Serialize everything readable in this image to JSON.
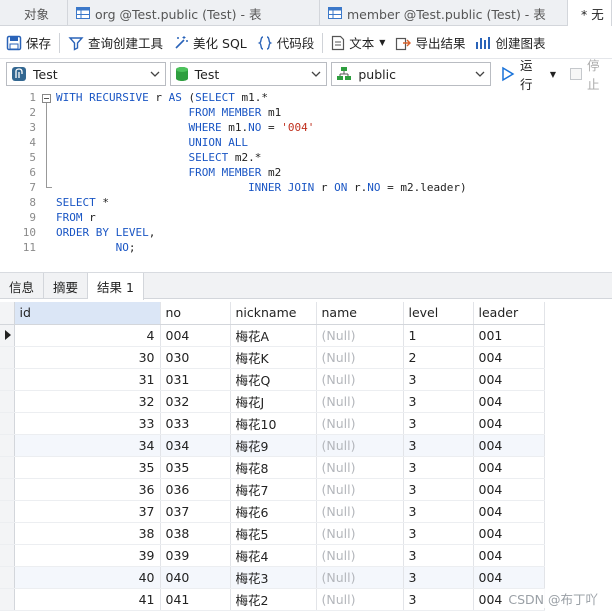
{
  "tabs": [
    {
      "label": "对象",
      "active": false
    },
    {
      "label": "org @Test.public (Test) - 表",
      "active": false
    },
    {
      "label": "member @Test.public (Test) - 表",
      "active": false
    },
    {
      "label": "* 无",
      "active": true
    }
  ],
  "toolbar": {
    "save": "保存",
    "query_builder": "查询创建工具",
    "beautify": "美化 SQL",
    "code_snippet": "代码段",
    "text": "文本",
    "export": "导出结果",
    "chart": "创建图表"
  },
  "selectors": {
    "connection": "Test",
    "database": "Test",
    "schema": "public",
    "run": "运行",
    "stop": "停止"
  },
  "editor": {
    "line_numbers": [
      "1",
      "2",
      "3",
      "4",
      "5",
      "6",
      "7",
      "8",
      "9",
      "10",
      "11"
    ]
  },
  "result_tabs": [
    "信息",
    "摘要",
    "结果 1"
  ],
  "grid": {
    "columns": [
      "id",
      "no",
      "nickname",
      "name",
      "level",
      "leader"
    ],
    "rows": [
      [
        "4",
        "004",
        "梅花A",
        "(Null)",
        "1",
        "001"
      ],
      [
        "30",
        "030",
        "梅花K",
        "(Null)",
        "2",
        "004"
      ],
      [
        "31",
        "031",
        "梅花Q",
        "(Null)",
        "3",
        "004"
      ],
      [
        "32",
        "032",
        "梅花J",
        "(Null)",
        "3",
        "004"
      ],
      [
        "33",
        "033",
        "梅花10",
        "(Null)",
        "3",
        "004"
      ],
      [
        "34",
        "034",
        "梅花9",
        "(Null)",
        "3",
        "004"
      ],
      [
        "35",
        "035",
        "梅花8",
        "(Null)",
        "3",
        "004"
      ],
      [
        "36",
        "036",
        "梅花7",
        "(Null)",
        "3",
        "004"
      ],
      [
        "37",
        "037",
        "梅花6",
        "(Null)",
        "3",
        "004"
      ],
      [
        "38",
        "038",
        "梅花5",
        "(Null)",
        "3",
        "004"
      ],
      [
        "39",
        "039",
        "梅花4",
        "(Null)",
        "3",
        "004"
      ],
      [
        "40",
        "040",
        "梅花3",
        "(Null)",
        "3",
        "004"
      ],
      [
        "41",
        "041",
        "梅花2",
        "(Null)",
        "3",
        "004"
      ]
    ]
  },
  "watermark": "CSDN @布丁吖",
  "colors": {
    "keyword": "#1a56c4",
    "string": "#c0301e",
    "accent": "#1a73d9"
  }
}
